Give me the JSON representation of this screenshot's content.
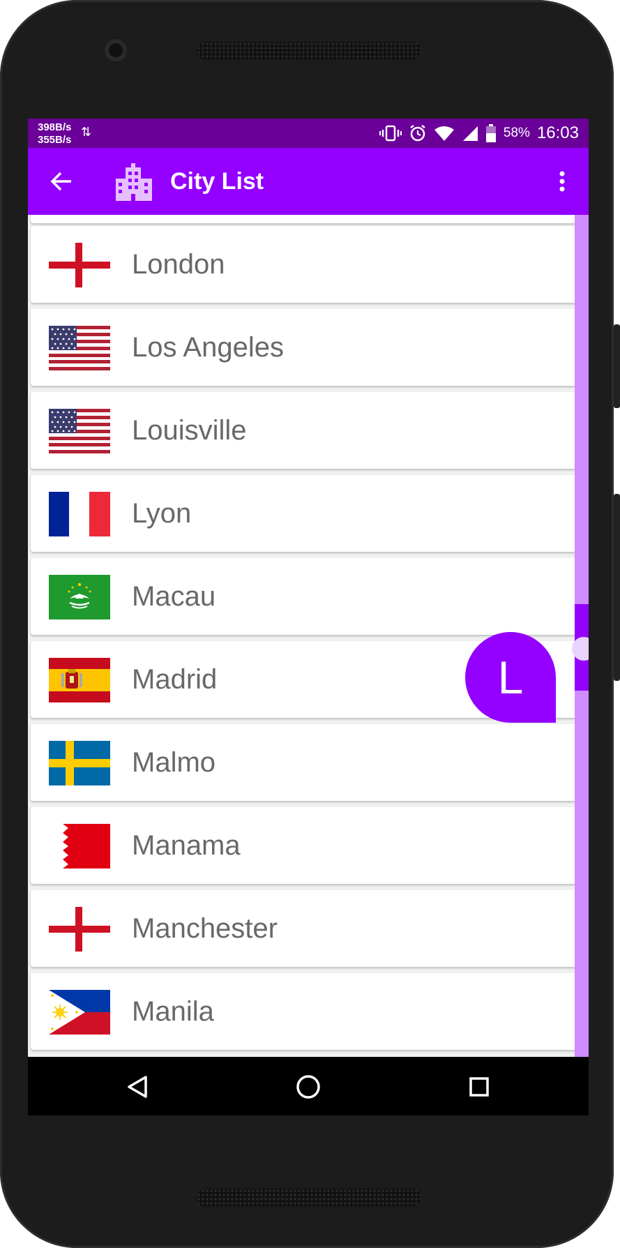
{
  "status_bar": {
    "net_up": "398B/s",
    "net_down": "355B/s",
    "battery": "58%",
    "time": "16:03",
    "icons": [
      "data-arrows-icon",
      "vibrate-icon",
      "alarm-icon",
      "wifi-icon",
      "signal-icon",
      "battery-icon"
    ]
  },
  "app_bar": {
    "title": "City List",
    "back_icon": "arrow-back-icon",
    "logo_icon": "city-buildings-icon",
    "menu_icon": "more-vert-icon"
  },
  "cities": [
    {
      "name": "London",
      "flag": "england"
    },
    {
      "name": "Los Angeles",
      "flag": "usa"
    },
    {
      "name": "Louisville",
      "flag": "usa"
    },
    {
      "name": "Lyon",
      "flag": "france"
    },
    {
      "name": "Macau",
      "flag": "macau"
    },
    {
      "name": "Madrid",
      "flag": "spain"
    },
    {
      "name": "Malmo",
      "flag": "sweden"
    },
    {
      "name": "Manama",
      "flag": "bahrain"
    },
    {
      "name": "Manchester",
      "flag": "england"
    },
    {
      "name": "Manila",
      "flag": "philippines"
    }
  ],
  "index_bubble": {
    "letter": "L"
  },
  "nav_bar": {
    "icons": [
      "back-triangle-icon",
      "home-circle-icon",
      "recents-square-icon"
    ]
  },
  "colors": {
    "primary": "#9400ff",
    "status_bar": "#6a0099",
    "scroll_track": "#cf8bff",
    "city_text": "#686868"
  }
}
